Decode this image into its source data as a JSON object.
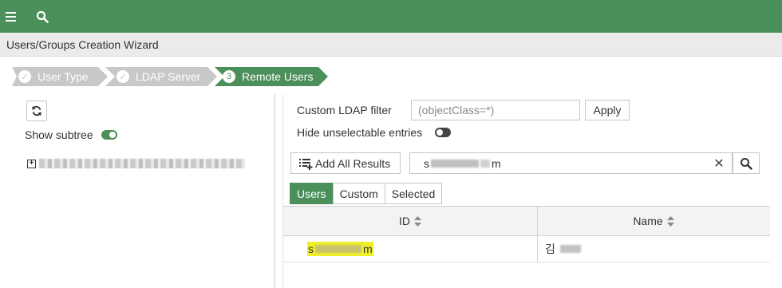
{
  "colors": {
    "accent": "#4b8f5a",
    "step_done": "#c8c8c8",
    "highlight": "#f0f028"
  },
  "topbar": {
    "menu_icon": "hamburger-menu-icon",
    "search_icon": "search-icon"
  },
  "window": {
    "title": "Users/Groups Creation Wizard"
  },
  "wizard": {
    "steps": [
      {
        "label": "User Type",
        "state": "done",
        "badge": "✓"
      },
      {
        "label": "LDAP Server",
        "state": "done",
        "badge": "✓"
      },
      {
        "label": "Remote Users",
        "state": "active",
        "badge": "3"
      }
    ]
  },
  "left_panel": {
    "refresh_icon": "refresh-icon",
    "show_subtree_label": "Show subtree",
    "show_subtree_on": true,
    "tree_expand_glyph": "+"
  },
  "right_panel": {
    "ldap_filter_label": "Custom LDAP filter",
    "ldap_filter_placeholder": "(objectClass=*)",
    "apply_label": "Apply",
    "hide_unselectable_label": "Hide unselectable entries",
    "hide_unselectable_on": false,
    "add_all_label": "Add All Results",
    "search_prefix": "s",
    "search_suffix": "m",
    "tabs": [
      "Users",
      "Custom",
      "Selected"
    ],
    "active_tab": "Users",
    "table": {
      "columns": [
        "ID",
        "Name"
      ],
      "rows": [
        {
          "id_prefix": "s",
          "id_suffix": "m",
          "name_prefix": "김"
        }
      ]
    }
  }
}
